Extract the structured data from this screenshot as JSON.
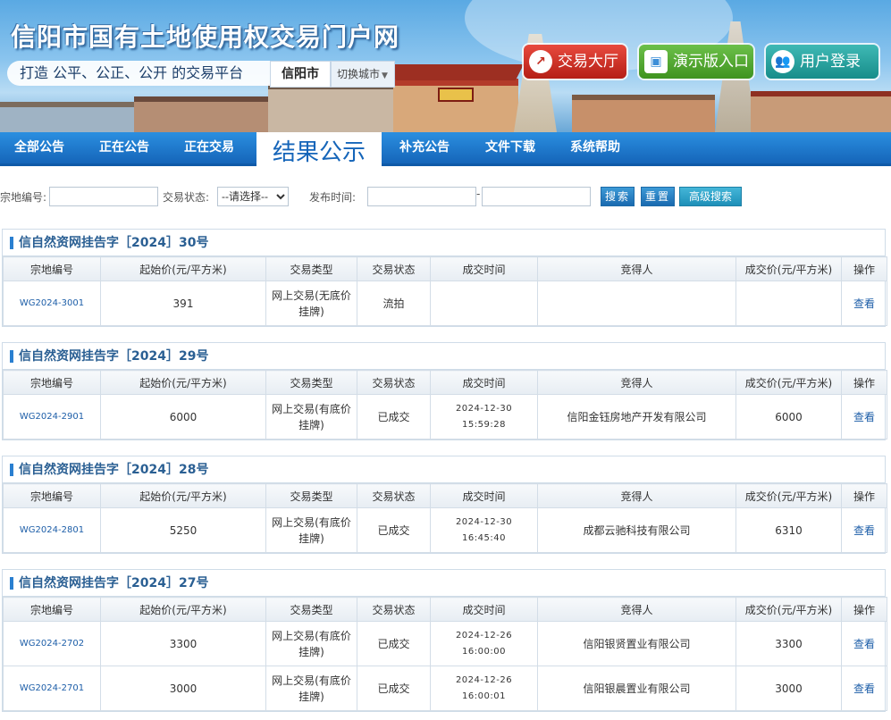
{
  "header": {
    "site_title": "信阳市国有土地使用权交易门户网",
    "slogan": "打造 公平、公正、公开 的交易平台",
    "city": "信阳市",
    "switch_city": "切换城市",
    "buttons": {
      "trade_hall": "交易大厅",
      "demo": "演示版入口",
      "login": "用户登录"
    }
  },
  "nav": {
    "items": [
      "全部公告",
      "正在公告",
      "正在交易",
      "结果公示",
      "补充公告",
      "文件下载",
      "系统帮助"
    ],
    "active": "结果公示"
  },
  "search": {
    "parcel_label": "宗地编号:",
    "status_label": "交易状态:",
    "status_selected": "--请选择--",
    "date_label": "发布时间:",
    "dash": "-",
    "search_btn": "搜索",
    "reset_btn": "重置",
    "advanced_btn": "高级搜索"
  },
  "columns": [
    "宗地编号",
    "起始价(元/平方米)",
    "交易类型",
    "交易状态",
    "成交时间",
    "竞得人",
    "成交价(元/平方米)",
    "操作"
  ],
  "blocks": [
    {
      "title": "信自然资网挂告字［2024］30号",
      "rows": [
        {
          "code": "WG2024-3001",
          "start": "391",
          "type": "网上交易(无底价挂牌)",
          "status": "流拍",
          "time": "",
          "winner": "",
          "price": "",
          "op": "查看"
        }
      ]
    },
    {
      "title": "信自然资网挂告字［2024］29号",
      "rows": [
        {
          "code": "WG2024-2901",
          "start": "6000",
          "type": "网上交易(有底价挂牌)",
          "status": "已成交",
          "time": "2024-12-30 15:59:28",
          "winner": "信阳金钰房地产开发有限公司",
          "price": "6000",
          "op": "查看"
        }
      ]
    },
    {
      "title": "信自然资网挂告字［2024］28号",
      "rows": [
        {
          "code": "WG2024-2801",
          "start": "5250",
          "type": "网上交易(有底价挂牌)",
          "status": "已成交",
          "time": "2024-12-30 16:45:40",
          "winner": "成都云驰科技有限公司",
          "price": "6310",
          "op": "查看"
        }
      ]
    },
    {
      "title": "信自然资网挂告字［2024］27号",
      "rows": [
        {
          "code": "WG2024-2702",
          "start": "3300",
          "type": "网上交易(有底价挂牌)",
          "status": "已成交",
          "time": "2024-12-26 16:00:00",
          "winner": "信阳银贤置业有限公司",
          "price": "3300",
          "op": "查看"
        },
        {
          "code": "WG2024-2701",
          "start": "3000",
          "type": "网上交易(有底价挂牌)",
          "status": "已成交",
          "time": "2024-12-26 16:00:01",
          "winner": "信阳银晨置业有限公司",
          "price": "3000",
          "op": "查看"
        }
      ]
    }
  ]
}
